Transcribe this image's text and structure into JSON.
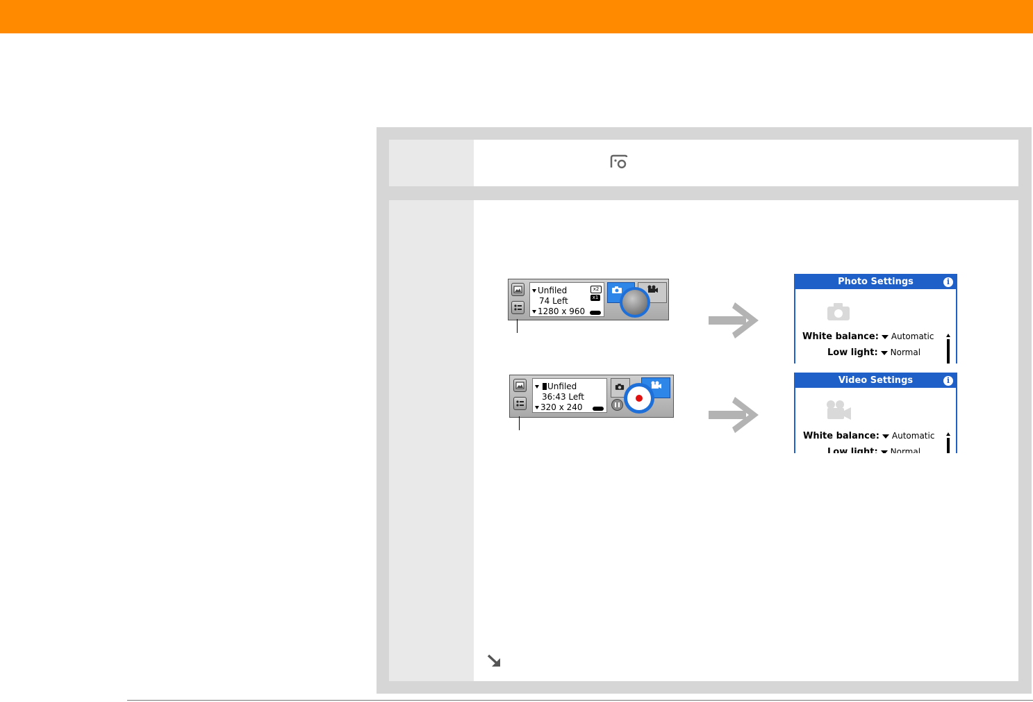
{
  "colors": {
    "accent": "#ff8a00",
    "panel": "#d6d6d6",
    "palm_blue": "#1f5fc8",
    "arrow": "#b3b3b3"
  },
  "icons": {
    "camera_app": "camera-app-icon",
    "arrow": "right-arrow-icon",
    "continue": "continue-arrow-icon"
  },
  "photo_bar": {
    "category": "Unfiled",
    "remaining": "74 Left",
    "resolution": "1280 x 960",
    "zoom_a": "x2",
    "zoom_b": "x1"
  },
  "video_bar": {
    "category": "Unfiled",
    "remaining": "36:43 Left",
    "resolution": "320 x 240"
  },
  "photo_settings": {
    "title": "Photo Settings",
    "white_balance_label": "White balance:",
    "white_balance_value": "Automatic",
    "low_light_label": "Low light:",
    "low_light_value": "Normal"
  },
  "video_settings": {
    "title": "Video Settings",
    "white_balance_label": "White balance:",
    "white_balance_value": "Automatic",
    "low_light_label": "Low light:",
    "low_light_value": "Normal"
  },
  "info_glyph": "i"
}
